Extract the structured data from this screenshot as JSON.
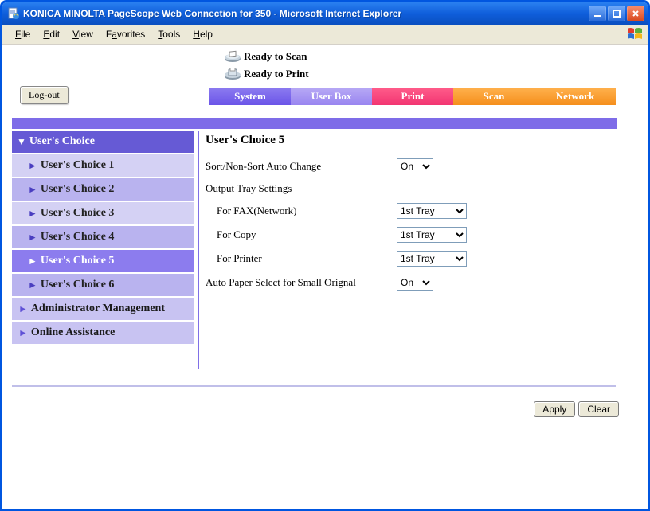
{
  "window": {
    "title": "KONICA MINOLTA PageScope Web Connection for 350 - Microsoft Internet Explorer"
  },
  "menu": {
    "file": "File",
    "edit": "Edit",
    "view": "View",
    "favorites": "Favorites",
    "tools": "Tools",
    "help": "Help"
  },
  "status": {
    "scan": "Ready to Scan",
    "print": "Ready to Print"
  },
  "logout_label": "Log-out",
  "tabs": {
    "system": "System",
    "userbox": "User Box",
    "print": "Print",
    "scan": "Scan",
    "network": "Network"
  },
  "sidebar": {
    "header": "User's Choice",
    "items": [
      "User's Choice 1",
      "User's Choice 2",
      "User's Choice 3",
      "User's Choice 4",
      "User's Choice 5",
      "User's Choice 6"
    ],
    "admin": "Administrator Management",
    "online": "Online Assistance"
  },
  "panel": {
    "title": "User's Choice 5",
    "sort_label": "Sort/Non-Sort Auto Change",
    "sort_value": "On",
    "output_tray_label": "Output Tray Settings",
    "fax_label": "For FAX(Network)",
    "fax_value": "1st Tray",
    "copy_label": "For Copy",
    "copy_value": "1st Tray",
    "printer_label": "For Printer",
    "printer_value": "1st Tray",
    "autopaper_label": "Auto Paper Select for Small Orignal",
    "autopaper_value": "On"
  },
  "buttons": {
    "apply": "Apply",
    "clear": "Clear"
  }
}
